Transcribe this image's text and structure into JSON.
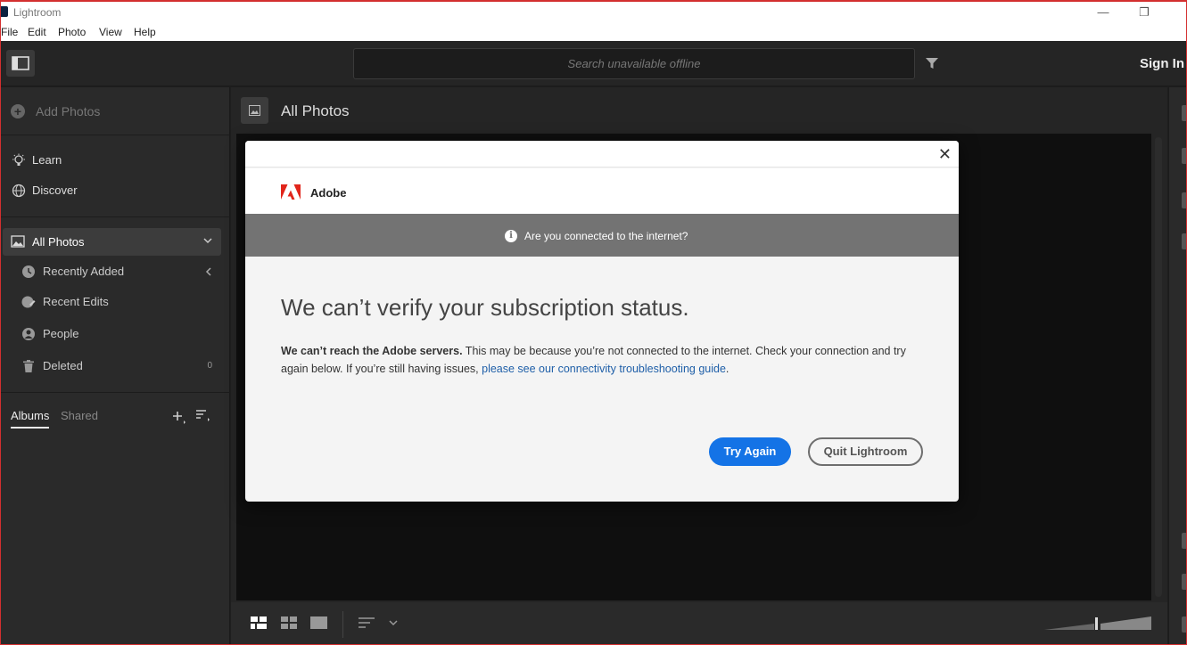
{
  "window": {
    "title": "Lightroom",
    "min_glyph": "—",
    "max_glyph": "❐"
  },
  "menu": [
    "File",
    "Edit",
    "Photo",
    "View",
    "Help"
  ],
  "topbar": {
    "search_placeholder": "Search unavailable offline",
    "sign_in": "Sign In"
  },
  "sidebar": {
    "add_photos": "Add Photos",
    "learn": "Learn",
    "discover": "Discover",
    "all_photos": "All Photos",
    "recently_added": "Recently Added",
    "recent_edits": "Recent Edits",
    "people": "People",
    "deleted": "Deleted",
    "deleted_count": "0",
    "tab_albums": "Albums",
    "tab_shared": "Shared"
  },
  "main": {
    "title": "All Photos"
  },
  "dialog": {
    "close_glyph": "✕",
    "brand": "Adobe",
    "banner": "Are you connected to the internet?",
    "heading": "We can’t verify your subscription status.",
    "body_bold": "We can’t reach the Adobe servers.",
    "body_text": " This may be because you’re not connected to the internet. Check your connection and try again below. If you’re still having issues, ",
    "body_link": "please see our connectivity troubleshooting guide",
    "body_end": ".",
    "try_again": "Try Again",
    "quit": "Quit Lightroom"
  },
  "colors": {
    "accent": "#1473e6",
    "adobe_red": "#e1251b",
    "frame": "#d32f2f"
  }
}
